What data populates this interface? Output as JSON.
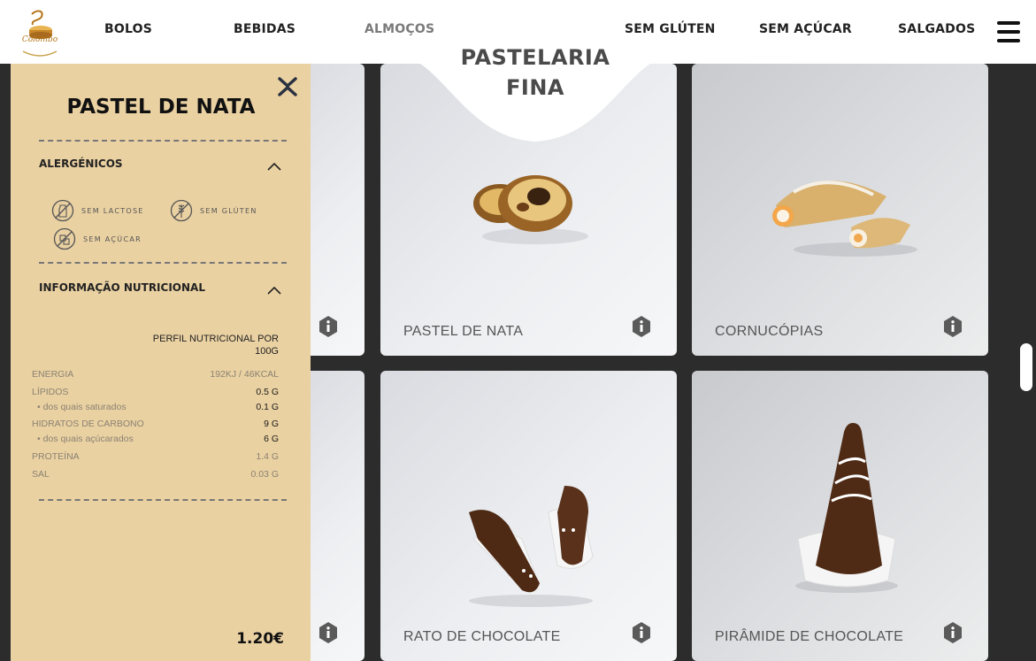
{
  "header": {
    "logo_text": "Colombo",
    "nav": [
      {
        "label": "BOLOS"
      },
      {
        "label": "BEBIDAS"
      },
      {
        "label": "ALMOÇOS"
      },
      {
        "label": "SEM GLÚTEN"
      },
      {
        "label": "SEM AÇÚCAR"
      },
      {
        "label": "SALGADOS"
      }
    ],
    "menu_icon": "hamburger-icon"
  },
  "page": {
    "title_line1": "PASTELARIA",
    "title_line2": "FINA"
  },
  "products": [
    {
      "name": "PASTEL DE NATA"
    },
    {
      "name": "CORNUCÓPIAS"
    },
    {
      "name": "RATO DE CHOCOLATE"
    },
    {
      "name": "PIRÂMIDE DE CHOCOLATE"
    }
  ],
  "panel": {
    "title": "PASTEL DE NATA",
    "close_icon": "close-icon",
    "allergens_title": "ALERGÉNICOS",
    "allergens": [
      {
        "label": "SEM LACTOSE",
        "icon": "no-lactose-icon"
      },
      {
        "label": "SEM GLÚTEN",
        "icon": "no-gluten-icon"
      },
      {
        "label": "SEM AÇÚCAR",
        "icon": "no-sugar-icon"
      }
    ],
    "nutrition_title": "INFORMAÇÃO NUTRICIONAL",
    "nutrition_header": "PERFIL NUTRICIONAL POR 100G",
    "nutrition": [
      {
        "label": "ENERGIA",
        "value": "192KJ / 46KCAL"
      },
      {
        "label": "LÍPIDOS",
        "value": "0.5 G"
      },
      {
        "label": "• dos quais saturados",
        "value": "0.1 G"
      },
      {
        "label": "HIDRATOS DE CARBONO",
        "value": "9 G"
      },
      {
        "label": "• dos quais açúcarados",
        "value": "6 G"
      },
      {
        "label": "PROTEÍNA",
        "value": "1.4 G"
      },
      {
        "label": "SAL",
        "value": "0.03 G"
      }
    ],
    "price": "1.20€"
  },
  "colors": {
    "panel_bg": "#ead1a2",
    "page_bg": "#2c2c2c",
    "accent": "#b47618"
  }
}
